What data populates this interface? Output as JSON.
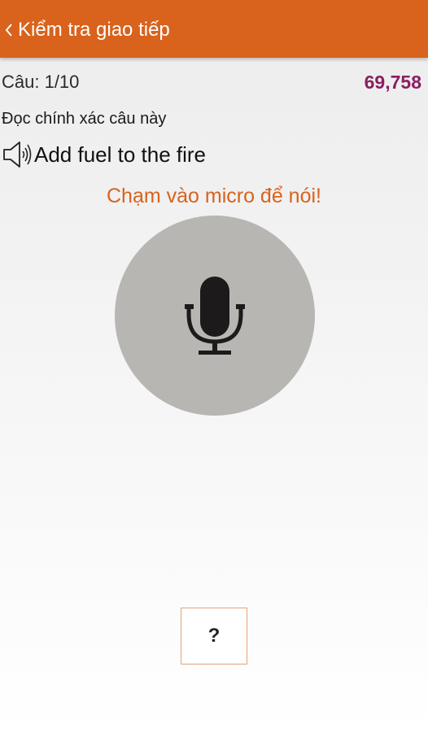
{
  "header": {
    "title": "Kiểm tra giao tiếp",
    "back_icon": "chevron-left-icon",
    "background_color": "#d9621c"
  },
  "quiz": {
    "counter": "Câu: 1/10",
    "score": "69,758",
    "score_color": "#8a1e63",
    "instruction": "Đọc chính xác câu này",
    "phrase": "Add fuel to the fire",
    "speaker_icon": "speaker-icon",
    "mic_prompt": "Chạm vào micro để nói!",
    "mic_icon": "microphone-icon",
    "mic_button_color": "#b8b6b2",
    "hint_label": "?"
  }
}
